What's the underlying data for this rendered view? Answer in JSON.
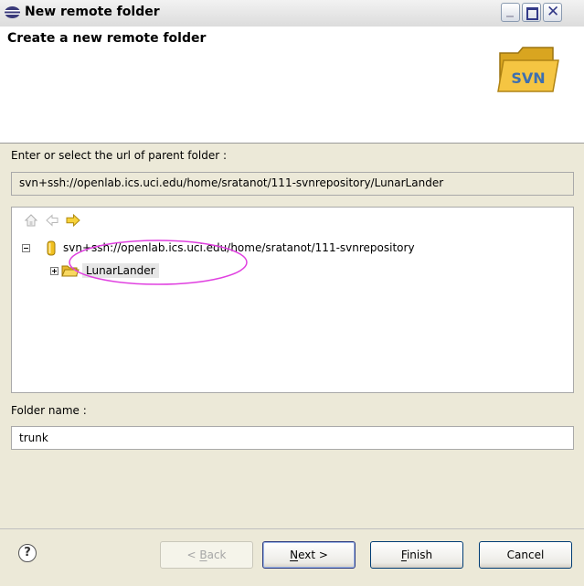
{
  "window": {
    "title": "New remote folder"
  },
  "banner": {
    "title": "Create a new remote folder",
    "logo_text": "SVN"
  },
  "url_section": {
    "label": "Enter or select the url of parent folder :",
    "value": "svn+ssh://openlab.ics.uci.edu/home/sratanot/111-svnrepository/LunarLander"
  },
  "tree": {
    "toolbar_icons": [
      "home-icon",
      "back-arrow-icon",
      "forward-arrow-icon"
    ],
    "root": {
      "label": "svn+ssh://openlab.ics.uci.edu/home/sratanot/111-svnrepository",
      "expanded": true,
      "children": [
        {
          "label": "LunarLander",
          "expanded": false,
          "selected": true
        }
      ]
    }
  },
  "folder_name": {
    "label": "Folder name :",
    "value": "trunk"
  },
  "buttons": {
    "back_prefix": "< ",
    "back_mnemonic": "B",
    "back_rest": "ack",
    "next_mnemonic": "N",
    "next_rest": "ext >",
    "finish_mnemonic": "F",
    "finish_rest": "inish",
    "cancel": "Cancel"
  },
  "help_symbol": "?",
  "colors": {
    "window_bg": "#ece9d8",
    "highlight_ellipse": "#e040e0",
    "folder_yellow": "#f5c542",
    "forward_arrow": "#f0c020"
  }
}
